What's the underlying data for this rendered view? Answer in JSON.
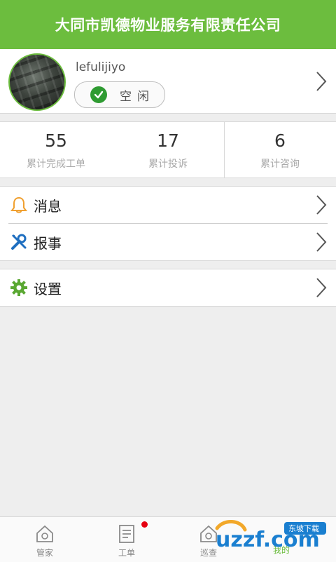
{
  "header": {
    "title": "大同市凯德物业服务有限责任公司"
  },
  "profile": {
    "username": "lefulijiyo",
    "status": "空闲"
  },
  "stats": [
    {
      "value": "55",
      "label": "累计完成工单"
    },
    {
      "value": "17",
      "label": "累计投诉"
    },
    {
      "value": "6",
      "label": "累计咨询"
    }
  ],
  "menu": {
    "messages": "消息",
    "report": "报事",
    "settings": "设置"
  },
  "nav": [
    {
      "label": "管家"
    },
    {
      "label": "工单"
    },
    {
      "label": "巡查"
    },
    {
      "label": "我的"
    }
  ],
  "colors": {
    "accent": "#6cbd3e",
    "badge": "#e60012"
  },
  "watermark": {
    "text": "uzzf.com",
    "badge": "东坡下载"
  }
}
